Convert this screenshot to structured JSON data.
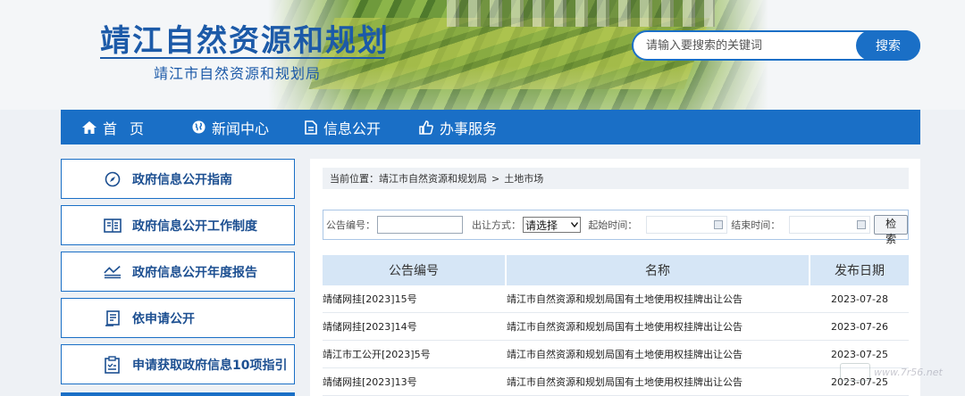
{
  "header": {
    "title": "靖江自然资源和规划",
    "subtitle": "靖江市自然资源和规划局",
    "search": {
      "placeholder": "请输入要搜索的关键词",
      "button": "搜索"
    }
  },
  "nav": {
    "items": [
      {
        "label": "首页",
        "icon": "home-icon"
      },
      {
        "label": "新闻中心",
        "icon": "globe-icon"
      },
      {
        "label": "信息公开",
        "icon": "document-icon"
      },
      {
        "label": "办事服务",
        "icon": "thumbs-up-icon"
      }
    ]
  },
  "sidebar": {
    "items": [
      {
        "label": "政府信息公开指南",
        "icon": "compass-icon"
      },
      {
        "label": "政府信息公开工作制度",
        "icon": "book-icon"
      },
      {
        "label": "政府信息公开年度报告",
        "icon": "chart-icon"
      },
      {
        "label": "依申请公开",
        "icon": "form-icon"
      },
      {
        "label": "申请获取政府信息10项指引",
        "icon": "clipboard-icon"
      }
    ]
  },
  "breadcrumb": {
    "prefix": "当前位置：",
    "items": [
      "靖江市自然资源和规划局",
      "土地市场"
    ],
    "separator": ">"
  },
  "filter": {
    "notice_no_label": "公告编号：",
    "notice_no_value": "",
    "method_label": "出让方式：",
    "method_selected": "请选择",
    "start_label": "起始时间：",
    "end_label": "结束时间：",
    "search_button": "检索"
  },
  "table": {
    "columns": [
      "公告编号",
      "名称",
      "发布日期"
    ],
    "rows": [
      {
        "no": "靖储网挂[2023]15号",
        "name": "靖江市自然资源和规划局国有土地使用权挂牌出让公告",
        "date": "2023-07-28"
      },
      {
        "no": "靖储网挂[2023]14号",
        "name": "靖江市自然资源和规划局国有土地使用权挂牌出让公告",
        "date": "2023-07-26"
      },
      {
        "no": "靖江市工公开[2023]5号",
        "name": "靖江市自然资源和规划局国有土地使用权挂牌出让公告",
        "date": "2023-07-25"
      },
      {
        "no": "靖储网挂[2023]13号",
        "name": "靖江市自然资源和规划局国有土地使用权挂牌出让公告",
        "date": "2023-07-25"
      }
    ]
  },
  "colors": {
    "primary": "#1a6fc6",
    "title": "#1c5aa8",
    "table_header": "#d6e6f6"
  },
  "watermark": {
    "text": "www.7r56.net"
  }
}
